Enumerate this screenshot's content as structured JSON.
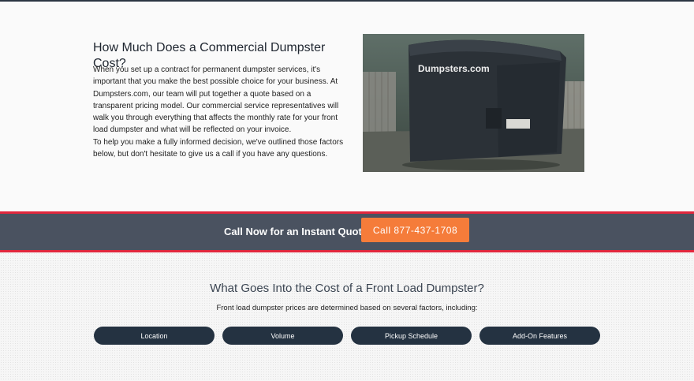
{
  "intro": {
    "title": "How Much Does a Commercial Dumpster Cost?",
    "paragraph1": "When you set up a contract for permanent dumpster services, it's important that you make the best possible choice for your business. At Dumpsters.com, our team will put together a quote based on a transparent pricing model. Our commercial service representatives will walk you through everything that affects the monthly rate for your front load dumpster and what will be reflected on your invoice.",
    "paragraph2": "To help you make a fully informed decision, we've outlined those factors below, but don't hesitate to give us a call if you have any questions.",
    "photo_brand": "Dumpsters.com"
  },
  "cta": {
    "text": "Call Now for an Instant Quote",
    "button_label": "Call 877-437-1708"
  },
  "factors": {
    "title": "What Goes Into the Cost of a Front Load Dumpster?",
    "subtitle": "Front load dumpster prices are determined based on several factors, including:",
    "pills": [
      "Location",
      "Volume",
      "Pickup Schedule",
      "Add-On Features"
    ]
  },
  "colors": {
    "dark_navy": "#243241",
    "cta_band": "#4a5260",
    "accent_red": "#e2273d",
    "cta_orange": "#f57c3a"
  }
}
